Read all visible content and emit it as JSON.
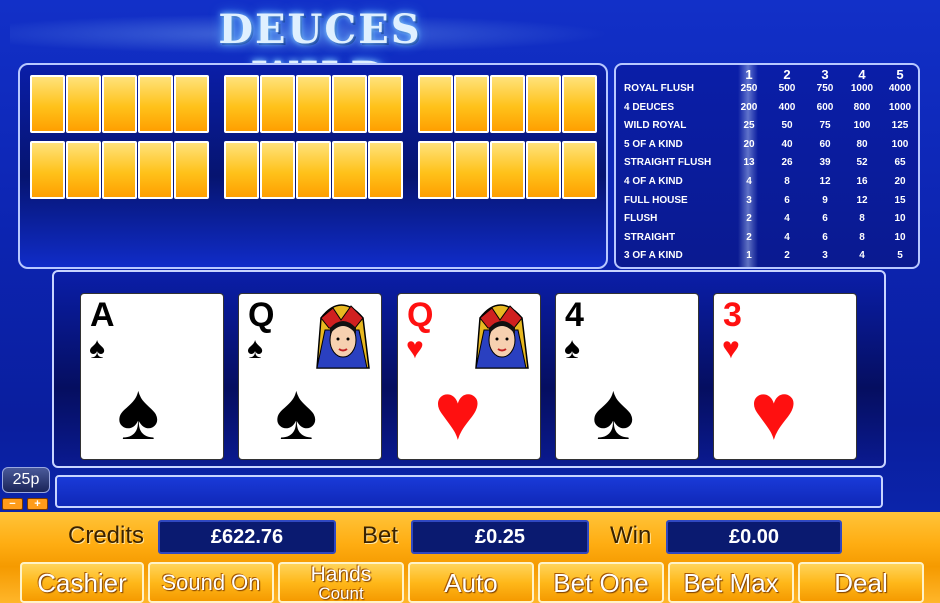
{
  "title": "DEUCES WILD",
  "paytable": {
    "columns": [
      "1",
      "2",
      "3",
      "4",
      "5"
    ],
    "rows": [
      {
        "name": "ROYAL FLUSH",
        "values": [
          "250",
          "500",
          "750",
          "1000",
          "4000"
        ]
      },
      {
        "name": "4 DEUCES",
        "values": [
          "200",
          "400",
          "600",
          "800",
          "1000"
        ]
      },
      {
        "name": "WILD ROYAL",
        "values": [
          "25",
          "50",
          "75",
          "100",
          "125"
        ]
      },
      {
        "name": "5 OF A KIND",
        "values": [
          "20",
          "40",
          "60",
          "80",
          "100"
        ]
      },
      {
        "name": "STRAIGHT FLUSH",
        "values": [
          "13",
          "26",
          "39",
          "52",
          "65"
        ]
      },
      {
        "name": "4 OF A KIND",
        "values": [
          "4",
          "8",
          "12",
          "16",
          "20"
        ]
      },
      {
        "name": "FULL HOUSE",
        "values": [
          "3",
          "6",
          "9",
          "12",
          "15"
        ]
      },
      {
        "name": "FLUSH",
        "values": [
          "2",
          "4",
          "6",
          "8",
          "10"
        ]
      },
      {
        "name": "STRAIGHT",
        "values": [
          "2",
          "4",
          "6",
          "8",
          "10"
        ]
      },
      {
        "name": "3 OF A KIND",
        "values": [
          "1",
          "2",
          "3",
          "4",
          "5"
        ]
      }
    ],
    "highlighted_column": "1"
  },
  "cards": [
    {
      "rank": "A",
      "suit": "♠",
      "color": "black",
      "face": false
    },
    {
      "rank": "Q",
      "suit": "♠",
      "color": "black",
      "face": true
    },
    {
      "rank": "Q",
      "suit": "♥",
      "color": "red",
      "face": true
    },
    {
      "rank": "4",
      "suit": "♠",
      "color": "black",
      "face": false
    },
    {
      "rank": "3",
      "suit": "♥",
      "color": "red",
      "face": false
    }
  ],
  "denomination": {
    "value": "25p",
    "decrease": "−",
    "increase": "+"
  },
  "meters": {
    "credits_label": "Credits",
    "credits_value": "£622.76",
    "bet_label": "Bet",
    "bet_value": "£0.25",
    "win_label": "Win",
    "win_value": "£0.00"
  },
  "buttons": {
    "cashier": "Cashier",
    "sound": "Sound On",
    "hands_l1": "Hands",
    "hands_l2": "Count",
    "auto": "Auto",
    "bet_one": "Bet One",
    "bet_max": "Bet Max",
    "deal": "Deal"
  },
  "colors": {
    "accent_gold": "#ffb81a",
    "panel_blue": "#0a1ea8",
    "card_back": "#ffc21a"
  }
}
